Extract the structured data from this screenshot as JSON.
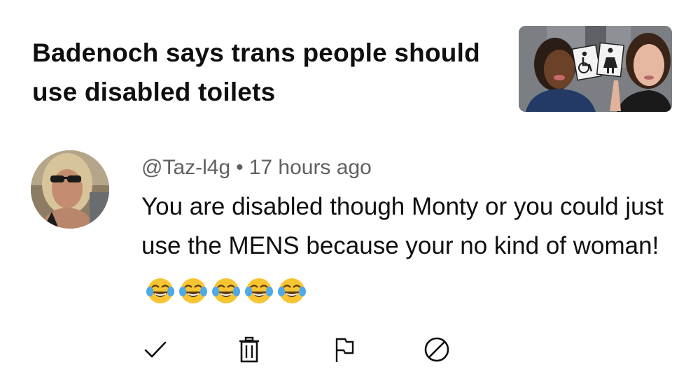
{
  "video": {
    "title": "Badenoch says trans people should use disabled toilets",
    "thumbnail_icon": "video-thumbnail"
  },
  "comment": {
    "author": "@Taz-l4g",
    "separator": "•",
    "time": "17 hours ago",
    "text": "You are disabled though Monty or you could just use the MENS because your no kind of woman!",
    "emoji_count": 5,
    "emoji_name": "face-with-tears-of-joy"
  },
  "actions": [
    {
      "name": "approve",
      "icon": "check-icon"
    },
    {
      "name": "delete",
      "icon": "trash-icon"
    },
    {
      "name": "report",
      "icon": "flag-icon"
    },
    {
      "name": "block",
      "icon": "block-icon"
    }
  ],
  "colors": {
    "text_primary": "#0f0f0f",
    "text_secondary": "#606060",
    "icon": "#0f0f0f",
    "emoji_face": "#f7c531",
    "emoji_tear": "#4fa8e8"
  }
}
